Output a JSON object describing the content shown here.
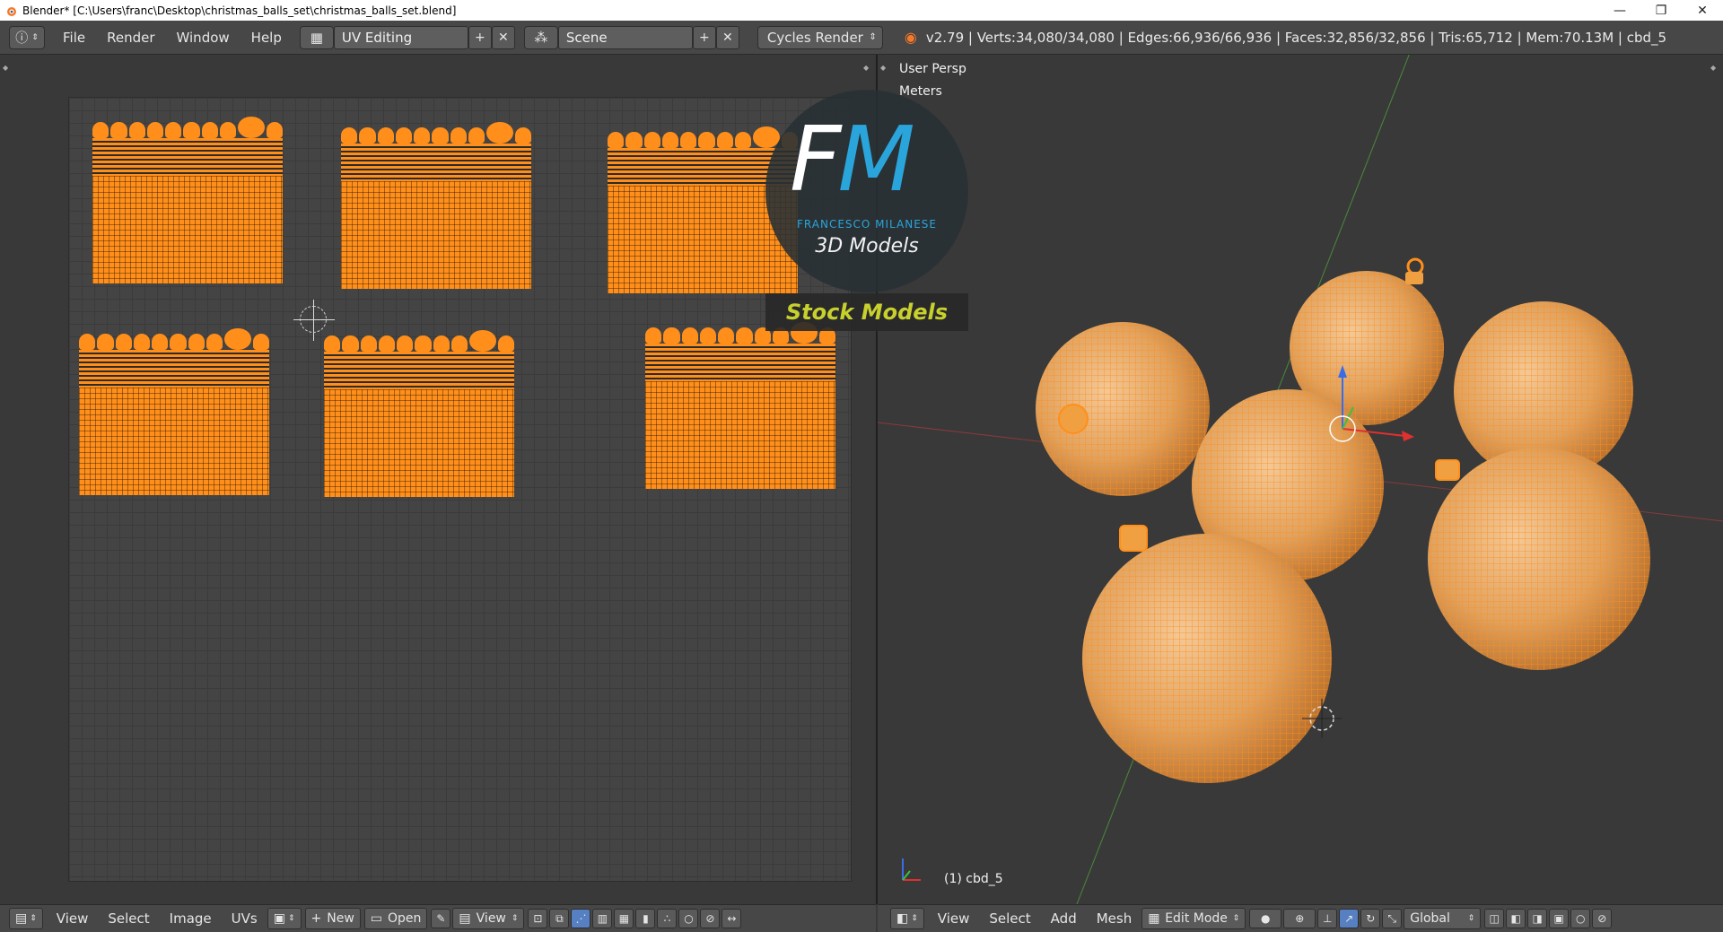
{
  "window": {
    "title": "Blender* [C:\\Users\\franc\\Desktop\\christmas_balls_set\\christmas_balls_set.blend]",
    "minimize": "—",
    "restore": "❐",
    "close": "✕"
  },
  "info_header": {
    "menus": [
      "File",
      "Render",
      "Window",
      "Help"
    ],
    "screen_layout": "UV Editing",
    "scene": "Scene",
    "render_engine": "Cycles Render",
    "stats": "v2.79 | Verts:34,080/34,080 | Edges:66,936/66,936 | Faces:32,856/32,856 | Tris:65,712 | Mem:70.13M | cbd_5"
  },
  "uv_editor": {
    "menus": [
      "View",
      "Select",
      "Image",
      "UVs"
    ],
    "new_label": "New",
    "open_label": "Open",
    "view_label": "View"
  },
  "viewport": {
    "view_name": "User Persp",
    "units": "Meters",
    "object_label": "(1) cbd_5",
    "menus": [
      "View",
      "Select",
      "Add",
      "Mesh"
    ],
    "mode": "Edit Mode",
    "orientation": "Global"
  },
  "watermark": {
    "letters_f": "F",
    "letters_m": "M",
    "name": "FRANCESCO MILANESE",
    "subtitle": "3D Models",
    "banner": "Stock Models"
  },
  "colors": {
    "selected_mesh": "#ff8f1a",
    "header_bg": "#474747",
    "editor_bg": "#393939",
    "brand_blue": "#2aa5dc",
    "banner_text": "#c8d02e"
  }
}
